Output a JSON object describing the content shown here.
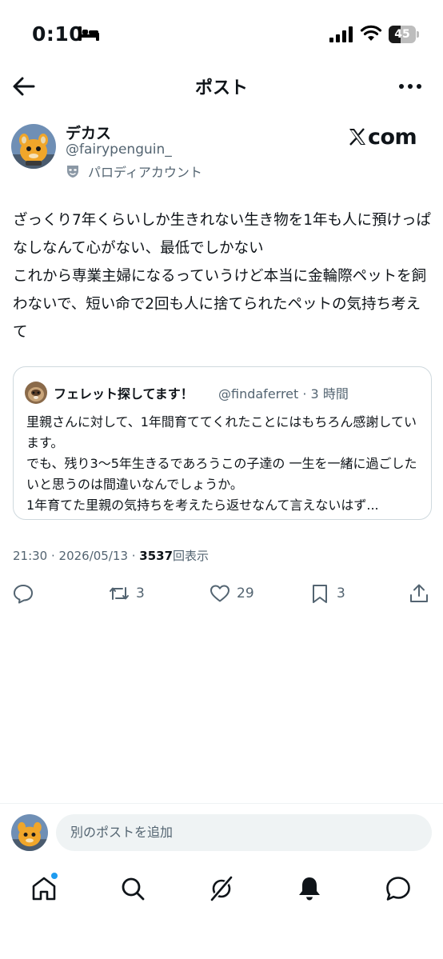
{
  "status_bar": {
    "time": "0:10",
    "battery_level": "45",
    "battery_fraction": 0.45
  },
  "header": {
    "title": "ポスト"
  },
  "author": {
    "name": "デカス",
    "handle": "@fairypenguin_",
    "badge_label": "パロディアカウント"
  },
  "watermark": {
    "text": "com"
  },
  "post": {
    "text": "ざっくり7年くらいしか生きれない生き物を1年も人に預けっぱなしなんて心がない、最低でしかない\nこれから専業主婦になるっていうけど本当に金輪際ペットを飼わないで、短い命で2回も人に捨てられたペットの気持ち考えて"
  },
  "quote": {
    "name": "フェレット探してます！",
    "handle_time": "@findaferret · 3 時間",
    "text": "里親さんに対して、1年間育ててくれたことにはもちろん感謝しています。\nでも、残り3〜5年生きるであろうこの子達の 一生を一緒に過ごしたいと思うのは間違いなんでしょうか。\n1年育てた里親の気持ちを考えたら返せなんて言えないはず..."
  },
  "meta": {
    "time_date": "21:30 · 2026/05/13 · ",
    "views": "3537",
    "views_label": "回表示"
  },
  "actions": {
    "reply_count": "",
    "retweet_count": "3",
    "like_count": "29",
    "bookmark_count": "3"
  },
  "reply_bar": {
    "placeholder": "別のポストを追加"
  },
  "icons": [
    "back-arrow-icon",
    "more-icon",
    "mask-icon",
    "x-logo-icon",
    "reply-icon",
    "retweet-icon",
    "heart-icon",
    "bookmark-icon",
    "share-icon",
    "home-icon",
    "search-icon",
    "grok-icon",
    "bell-icon",
    "messages-icon"
  ],
  "colors": {
    "text": "#0f1419",
    "secondary": "#536471",
    "border": "#cfd9de",
    "accent": "#1d9bf0"
  }
}
